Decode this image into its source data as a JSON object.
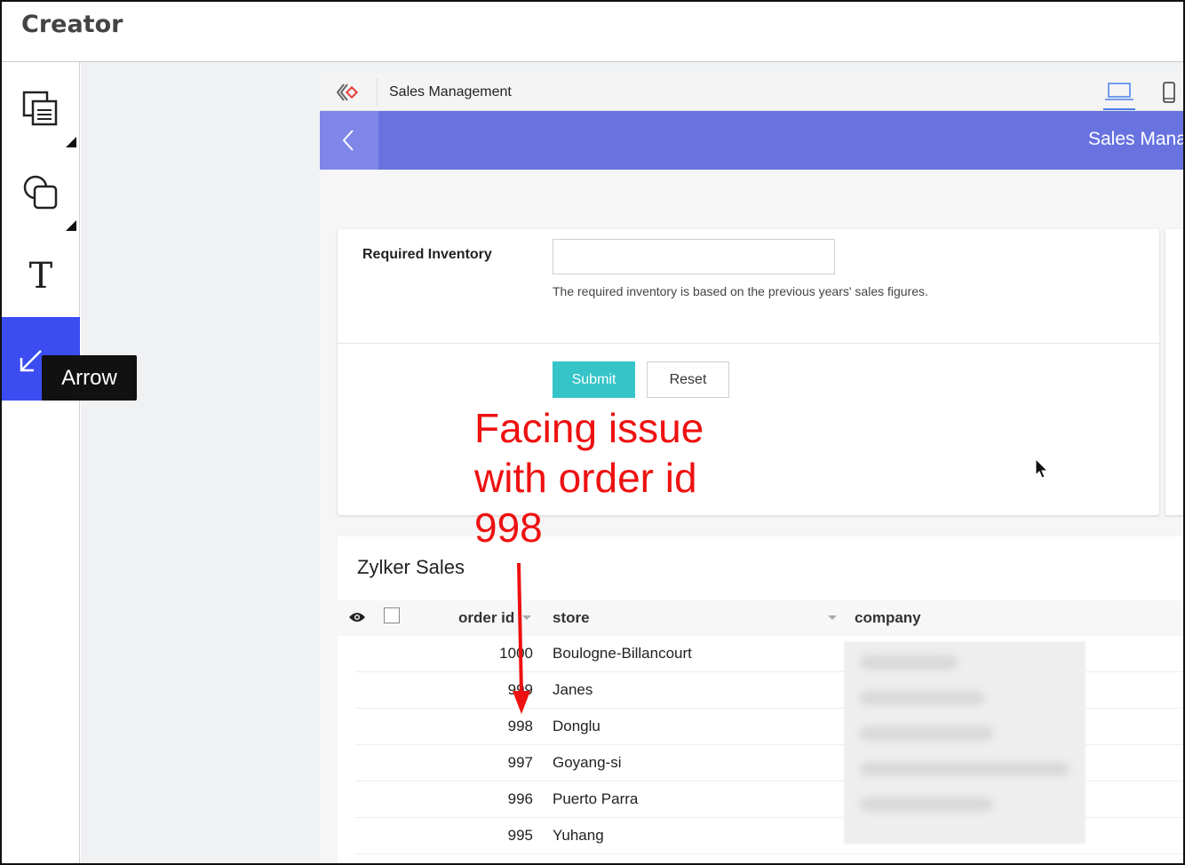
{
  "app": {
    "title": "Creator"
  },
  "tools": {
    "tooltip": "Arrow",
    "items": [
      {
        "icon": "layers-icon"
      },
      {
        "icon": "shapes-icon"
      },
      {
        "icon": "text-icon",
        "glyph": "T"
      },
      {
        "icon": "arrow-tool-icon",
        "active": true
      }
    ]
  },
  "preview": {
    "app_name": "Sales Management",
    "header_title": "Sales Management",
    "form": {
      "field_label": "Required Inventory",
      "field_value": "",
      "help_text": "The required inventory is based on the previous years' sales figures.",
      "submit_label": "Submit",
      "reset_label": "Reset"
    },
    "report": {
      "title": "Zylker Sales",
      "columns": [
        "order id",
        "store",
        "company"
      ],
      "rows": [
        {
          "order_id": "1000",
          "store": "Boulogne-Billancourt"
        },
        {
          "order_id": "999",
          "store": "Janes"
        },
        {
          "order_id": "998",
          "store": "Donglu"
        },
        {
          "order_id": "997",
          "store": "Goyang-si"
        },
        {
          "order_id": "996",
          "store": "Puerto Parra"
        },
        {
          "order_id": "995",
          "store": "Yuhang"
        }
      ]
    }
  },
  "annotation": {
    "text": "Facing issue with order id 998",
    "color": "#ee1111"
  },
  "colors": {
    "active_tool": "#3b4cf0",
    "app_header": "#6873e0",
    "submit": "#35c4c8"
  }
}
